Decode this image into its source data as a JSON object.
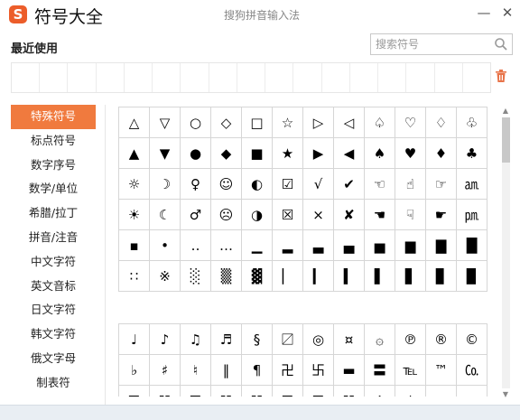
{
  "window": {
    "title": "符号大全",
    "subtitle": "搜狗拼音输入法",
    "logo_glyph": "S",
    "minimize_glyph": "—",
    "close_glyph": "✕",
    "accent_color": "#f07a3e"
  },
  "recent": {
    "label": "最近使用",
    "cell_count": 17
  },
  "search": {
    "placeholder": "搜索符号",
    "value": ""
  },
  "categories": [
    {
      "label": "特殊符号",
      "active": true
    },
    {
      "label": "标点符号",
      "active": false
    },
    {
      "label": "数字序号",
      "active": false
    },
    {
      "label": "数学/单位",
      "active": false
    },
    {
      "label": "希腊/拉丁",
      "active": false
    },
    {
      "label": "拼音/注音",
      "active": false
    },
    {
      "label": "中文字符",
      "active": false
    },
    {
      "label": "英文音标",
      "active": false
    },
    {
      "label": "日文字符",
      "active": false
    },
    {
      "label": "韩文字符",
      "active": false
    },
    {
      "label": "俄文字母",
      "active": false
    },
    {
      "label": "制表符",
      "active": false
    }
  ],
  "symbols_group1": [
    "△",
    "▽",
    "○",
    "◇",
    "□",
    "☆",
    "▷",
    "◁",
    "♤",
    "♡",
    "♢",
    "♧",
    "▲",
    "▼",
    "●",
    "◆",
    "■",
    "★",
    "▶",
    "◀",
    "♠",
    "♥",
    "♦",
    "♣",
    "☼",
    "☽",
    "♀",
    "☺",
    "◐",
    "☑",
    "√",
    "✔",
    "☜",
    "☝",
    "☞",
    "㏂",
    "☀",
    "☾",
    "♂",
    "☹",
    "◑",
    "☒",
    "×",
    "✘",
    "☚",
    "☟",
    "☛",
    "㏘",
    "▪",
    "•",
    "‥",
    "…",
    "▁",
    "▂",
    "▃",
    "▄",
    "▅",
    "▆",
    "▇",
    "█",
    "∷",
    "※",
    "░",
    "▒",
    "▓",
    "▏",
    "▎",
    "▍",
    "▌",
    "▋",
    "▊",
    "▉"
  ],
  "symbols_group2": [
    "♩",
    "♪",
    "♫",
    "♬",
    "§",
    "〼",
    "◎",
    "¤",
    "۞",
    "℗",
    "®",
    "©",
    "♭",
    "♯",
    "♮",
    "‖",
    "¶",
    "卍",
    "卐",
    "▬",
    "〓",
    "℡",
    "™",
    "㏇",
    "☰",
    "☷",
    "☲",
    "☵",
    "☳",
    "☴",
    "☶",
    "☱",
    "↑",
    "↓",
    "←",
    "→"
  ]
}
